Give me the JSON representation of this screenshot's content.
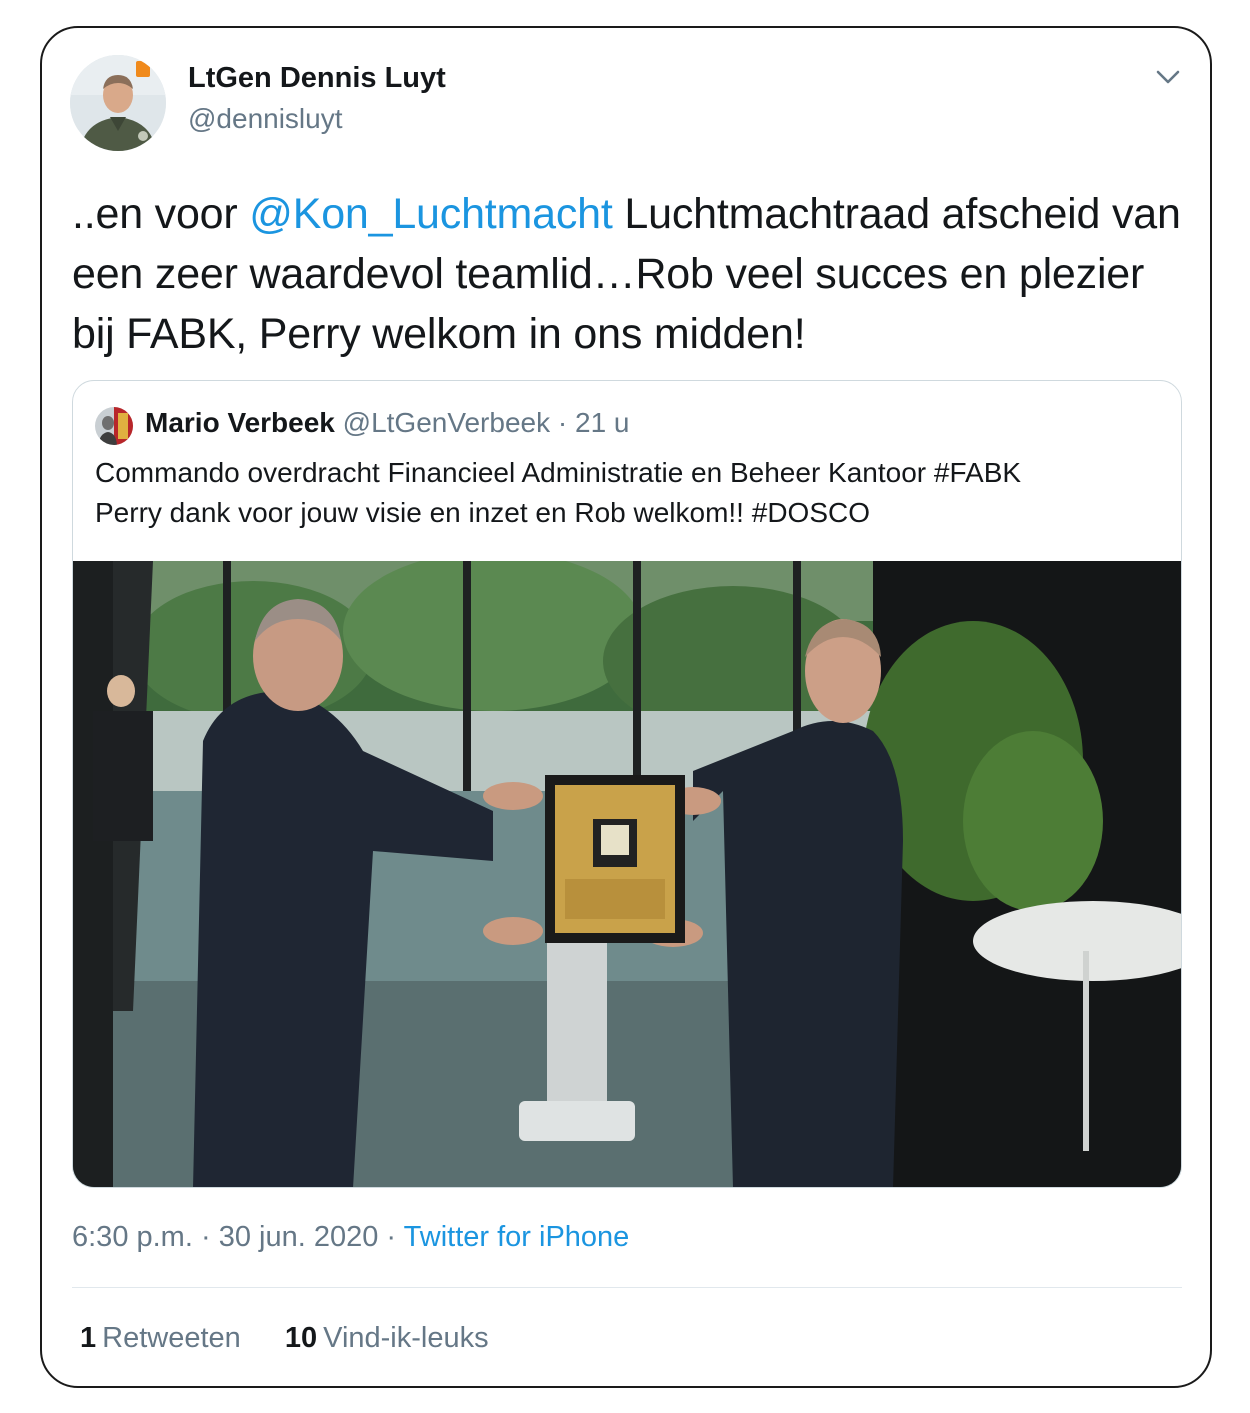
{
  "tweet": {
    "author": {
      "name": "LtGen Dennis Luyt",
      "handle": "@dennisluyt",
      "avatar_icon": "profile-photo-uniform"
    },
    "text_prefix": "..en voor ",
    "mention": "@Kon_Luchtmacht",
    "text_suffix": " Luchtmachtraad afscheid van een zeer waardevol teamlid…Rob veel succes en plezier bij FABK, Perry welkom in ons midden!",
    "quoted": {
      "name": "Mario Verbeek",
      "handle": "@LtGenVerbeek",
      "separator": "·",
      "time": "21 u",
      "text_line1": "Commando overdracht Financieel Administratie en Beheer Kantoor #FABK",
      "text_line2": "Perry dank voor jouw visie en inzet en Rob welkom!! #DOSCO"
    },
    "meta": {
      "time": "6:30 p.m.",
      "separator": "·",
      "date": "30 jun. 2020",
      "source": "Twitter for iPhone"
    },
    "stats": {
      "retweets_count": "1",
      "retweets_label": "Retweeten",
      "likes_count": "10",
      "likes_label": "Vind-ik-leuks"
    }
  },
  "colors": {
    "link": "#1b95e0",
    "secondary_text": "#657786",
    "border": "#cfd9de"
  }
}
